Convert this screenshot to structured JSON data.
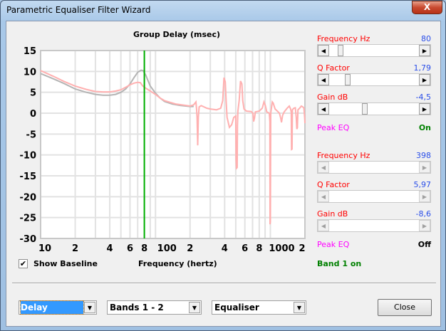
{
  "window": {
    "title": "Parametric Equaliser Filter Wizard",
    "close_glyph": "X"
  },
  "chart_data": {
    "type": "line",
    "title": "Group Delay (msec)",
    "xlabel": "Frequency (hertz)",
    "ylabel": "",
    "xscale": "log",
    "xlim": [
      10,
      2000
    ],
    "ylim": [
      -30,
      15
    ],
    "yticks": [
      "15",
      "10",
      "5",
      "0",
      "-5",
      "-10",
      "-15",
      "-20",
      "-25",
      "-30"
    ],
    "ytick_values": [
      15,
      10,
      5,
      0,
      -5,
      -10,
      -15,
      -20,
      -25,
      -30
    ],
    "xtick_labels": [
      {
        "f": 10,
        "t": "10"
      },
      {
        "f": 20,
        "t": "2"
      },
      {
        "f": 40,
        "t": "4"
      },
      {
        "f": 60,
        "t": "6"
      },
      {
        "f": 80,
        "t": "8"
      },
      {
        "f": 100,
        "t": "100"
      },
      {
        "f": 200,
        "t": "2"
      },
      {
        "f": 400,
        "t": "4"
      },
      {
        "f": 600,
        "t": "6"
      },
      {
        "f": 800,
        "t": "8"
      },
      {
        "f": 1000,
        "t": "1000"
      },
      {
        "f": 2000,
        "t": "2"
      }
    ],
    "grid": true,
    "marker_frequency": 80,
    "series": [
      {
        "name": "baseline",
        "color": "#b4b4b4",
        "points": [
          [
            10,
            9.5
          ],
          [
            13,
            8.2
          ],
          [
            16,
            7.1
          ],
          [
            20,
            5.8
          ],
          [
            25,
            5
          ],
          [
            30,
            4.5
          ],
          [
            35,
            4.3
          ],
          [
            40,
            4.3
          ],
          [
            45,
            4.5
          ],
          [
            50,
            5
          ],
          [
            55,
            5.8
          ],
          [
            60,
            7
          ],
          [
            65,
            8.5
          ],
          [
            70,
            9.8
          ],
          [
            75,
            10.3
          ],
          [
            78,
            10.2
          ],
          [
            82,
            9.2
          ],
          [
            90,
            6.5
          ],
          [
            100,
            4.8
          ],
          [
            110,
            3.6
          ],
          [
            120,
            2.8
          ],
          [
            140,
            2.2
          ],
          [
            160,
            1.9
          ],
          [
            200,
            1.6
          ],
          [
            215,
            1.6
          ]
        ]
      },
      {
        "name": "equalised",
        "color": "#ffb0b0",
        "points": [
          [
            10,
            10.2
          ],
          [
            13,
            8.8
          ],
          [
            16,
            7.6
          ],
          [
            20,
            6.5
          ],
          [
            25,
            5.7
          ],
          [
            30,
            5.2
          ],
          [
            35,
            5.1
          ],
          [
            40,
            5.1
          ],
          [
            45,
            5.3
          ],
          [
            50,
            5.6
          ],
          [
            55,
            6.2
          ],
          [
            60,
            6.8
          ],
          [
            65,
            7.2
          ],
          [
            70,
            7.4
          ],
          [
            74,
            7.3
          ],
          [
            77,
            6.6
          ],
          [
            80,
            6.2
          ],
          [
            90,
            5.3
          ],
          [
            100,
            4.5
          ],
          [
            110,
            3.6
          ],
          [
            120,
            3
          ],
          [
            150,
            2.2
          ],
          [
            200,
            1.7
          ],
          [
            215,
            2
          ],
          [
            225,
            2.7
          ],
          [
            228,
            1
          ],
          [
            230,
            -1
          ],
          [
            233,
            -7.7
          ],
          [
            236,
            -1
          ],
          [
            240,
            1.5
          ],
          [
            250,
            1.8
          ],
          [
            280,
            1.2
          ],
          [
            300,
            1
          ],
          [
            340,
            0.8
          ],
          [
            370,
            1.2
          ],
          [
            385,
            3
          ],
          [
            395,
            8.5
          ],
          [
            405,
            7.5
          ],
          [
            412,
            3
          ],
          [
            420,
            -1
          ],
          [
            440,
            -3.4
          ],
          [
            460,
            -2.8
          ],
          [
            480,
            -1
          ],
          [
            500,
            -0.7
          ],
          [
            503,
            -11
          ],
          [
            507,
            -13.2
          ],
          [
            514,
            -13
          ],
          [
            517,
            -3
          ],
          [
            522,
            0.5
          ],
          [
            535,
            3
          ],
          [
            550,
            7.7
          ],
          [
            565,
            7
          ],
          [
            575,
            3
          ],
          [
            590,
            1
          ],
          [
            620,
            0.5
          ],
          [
            680,
            0.4
          ],
          [
            705,
            0
          ],
          [
            715,
            -2
          ],
          [
            728,
            -1.2
          ],
          [
            740,
            0.3
          ],
          [
            800,
            0.5
          ],
          [
            850,
            1.2
          ],
          [
            880,
            2.7
          ],
          [
            905,
            1.8
          ],
          [
            930,
            0.3
          ],
          [
            980,
            0
          ],
          [
            990,
            -2
          ],
          [
            994,
            -26.6
          ],
          [
            1000,
            -26
          ],
          [
            1008,
            0
          ],
          [
            1040,
            2.7
          ],
          [
            1060,
            2.4
          ],
          [
            1100,
            1
          ],
          [
            1150,
            0.5
          ],
          [
            1200,
            0
          ],
          [
            1230,
            -1.2
          ],
          [
            1250,
            -2.2
          ],
          [
            1280,
            -0.5
          ],
          [
            1320,
            0.3
          ],
          [
            1400,
            1.2
          ],
          [
            1460,
            1.7
          ],
          [
            1500,
            1
          ],
          [
            1520,
            0.2
          ],
          [
            1530,
            -8.7
          ],
          [
            1545,
            -8.6
          ],
          [
            1555,
            0.8
          ],
          [
            1600,
            1.2
          ],
          [
            1650,
            1.3
          ],
          [
            1680,
            -1
          ],
          [
            1700,
            -3.8
          ],
          [
            1720,
            -3.5
          ],
          [
            1740,
            0.8
          ],
          [
            1800,
            1.2
          ],
          [
            1860,
            1.7
          ],
          [
            1920,
            1.5
          ],
          [
            1960,
            1.2
          ],
          [
            1990,
            -1
          ],
          [
            2000,
            -2.4
          ]
        ]
      }
    ]
  },
  "show_baseline": {
    "label": "Show Baseline",
    "checked": true
  },
  "bands": [
    {
      "frequency_label": "Frequency  Hz",
      "frequency_value": "80",
      "frequency_pos": 0.1,
      "q_label": "Q Factor",
      "q_value": "1,79",
      "q_pos": 0.19,
      "gain_label": "Gain  dB",
      "gain_value": "-4,5",
      "gain_pos": 0.39,
      "type_label": "Peak EQ",
      "state": "On",
      "enabled": true
    },
    {
      "frequency_label": "Frequency  Hz",
      "frequency_value": "398",
      "q_label": "Q Factor",
      "q_value": "5,97",
      "gain_label": "Gain  dB",
      "gain_value": "-8,6",
      "type_label": "Peak EQ",
      "state": "Off",
      "enabled": false
    }
  ],
  "band_status": "Band 1 on",
  "dropdowns": {
    "view": "Delay",
    "bands": "Bands 1 - 2",
    "mode": "Equaliser"
  },
  "close_label": "Close"
}
